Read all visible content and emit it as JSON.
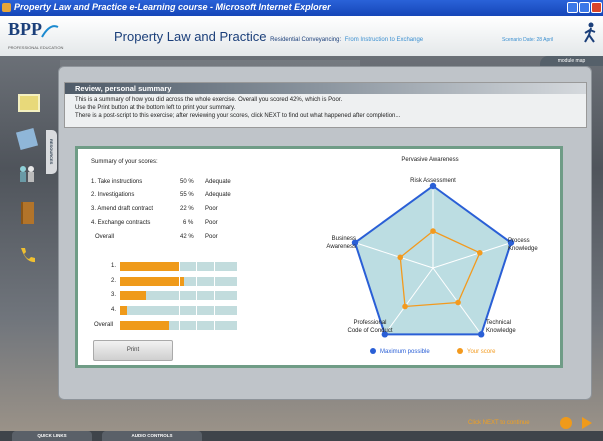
{
  "window": {
    "title": "Property Law and Practice e-Learning course - Microsoft Internet Explorer"
  },
  "header": {
    "logo_text": "BPP",
    "logo_sub": "PROFESSIONAL EDUCATION",
    "app_title": "Property Law and Practice",
    "course": "Residential Conveyancing:",
    "stage": "From Instruction to Exchange",
    "scenario_date": "Scenario Date: 28 April",
    "module_map": "module map"
  },
  "sidebar": {
    "resources_tab": "RESOURCES",
    "icons": [
      "note-icon",
      "notepad-icon",
      "people-icon",
      "files-icon",
      "phone-icon"
    ]
  },
  "review": {
    "heading": "Review, personal summary",
    "lines": [
      "This is a summary of how you did across the whole exercise. Overall you scored 42%, which is Poor.",
      "Use the Print button at the bottom left to print your summary.",
      "There is a post-script to this exercise; after reviewing your scores, click NEXT to find out what happened after completion..."
    ]
  },
  "scores": {
    "title": "Summary of your scores:",
    "rows": [
      {
        "label": "1. Take instructions",
        "pct": "50 %",
        "rating": "Adequate",
        "value": 50
      },
      {
        "label": "2. Investigations",
        "pct": "55 %",
        "rating": "Adequate",
        "value": 55
      },
      {
        "label": "3. Amend draft contract",
        "pct": "22 %",
        "rating": "Poor",
        "value": 22
      },
      {
        "label": "4. Exchange contracts",
        "pct": "6 %",
        "rating": "Poor",
        "value": 6
      },
      {
        "label": "Overall",
        "pct": "42 %",
        "rating": "Poor",
        "value": 42
      }
    ],
    "bar_labels": [
      "1.",
      "2.",
      "3.",
      "4.",
      "Overall"
    ],
    "print_label": "Print"
  },
  "chart_data": {
    "type": "radar",
    "title": "Pervasive Awareness",
    "axes": [
      "Risk Assessment",
      "Process Knowledge",
      "Technical Knowledge",
      "Professional Code of Conduct",
      "Business Awareness"
    ],
    "axis_labels": {
      "risk": "Risk Assessment",
      "process": [
        "Process",
        "Knowledge"
      ],
      "technical": [
        "Technical",
        "Knowledge"
      ],
      "professional": [
        "Professional",
        "Code of Conduct"
      ],
      "business": [
        "Business",
        "Awareness"
      ]
    },
    "series": [
      {
        "name": "Maximum possible",
        "values": [
          100,
          100,
          100,
          100,
          100
        ],
        "color": "#2a5fd6"
      },
      {
        "name": "Your score",
        "values": [
          45,
          60,
          52,
          58,
          42
        ],
        "color": "#f39a1e"
      }
    ],
    "rmax": 100,
    "legend_position": "bottom"
  },
  "footer": {
    "quick_links": "QUICK LINKS",
    "audio_controls": "AUDIO CONTROLS",
    "click_next": "Click NEXT to continue"
  },
  "colors": {
    "accent_orange": "#ef9a1a",
    "track": "#c2dcdd",
    "brand_blue": "#1b3f7a"
  }
}
